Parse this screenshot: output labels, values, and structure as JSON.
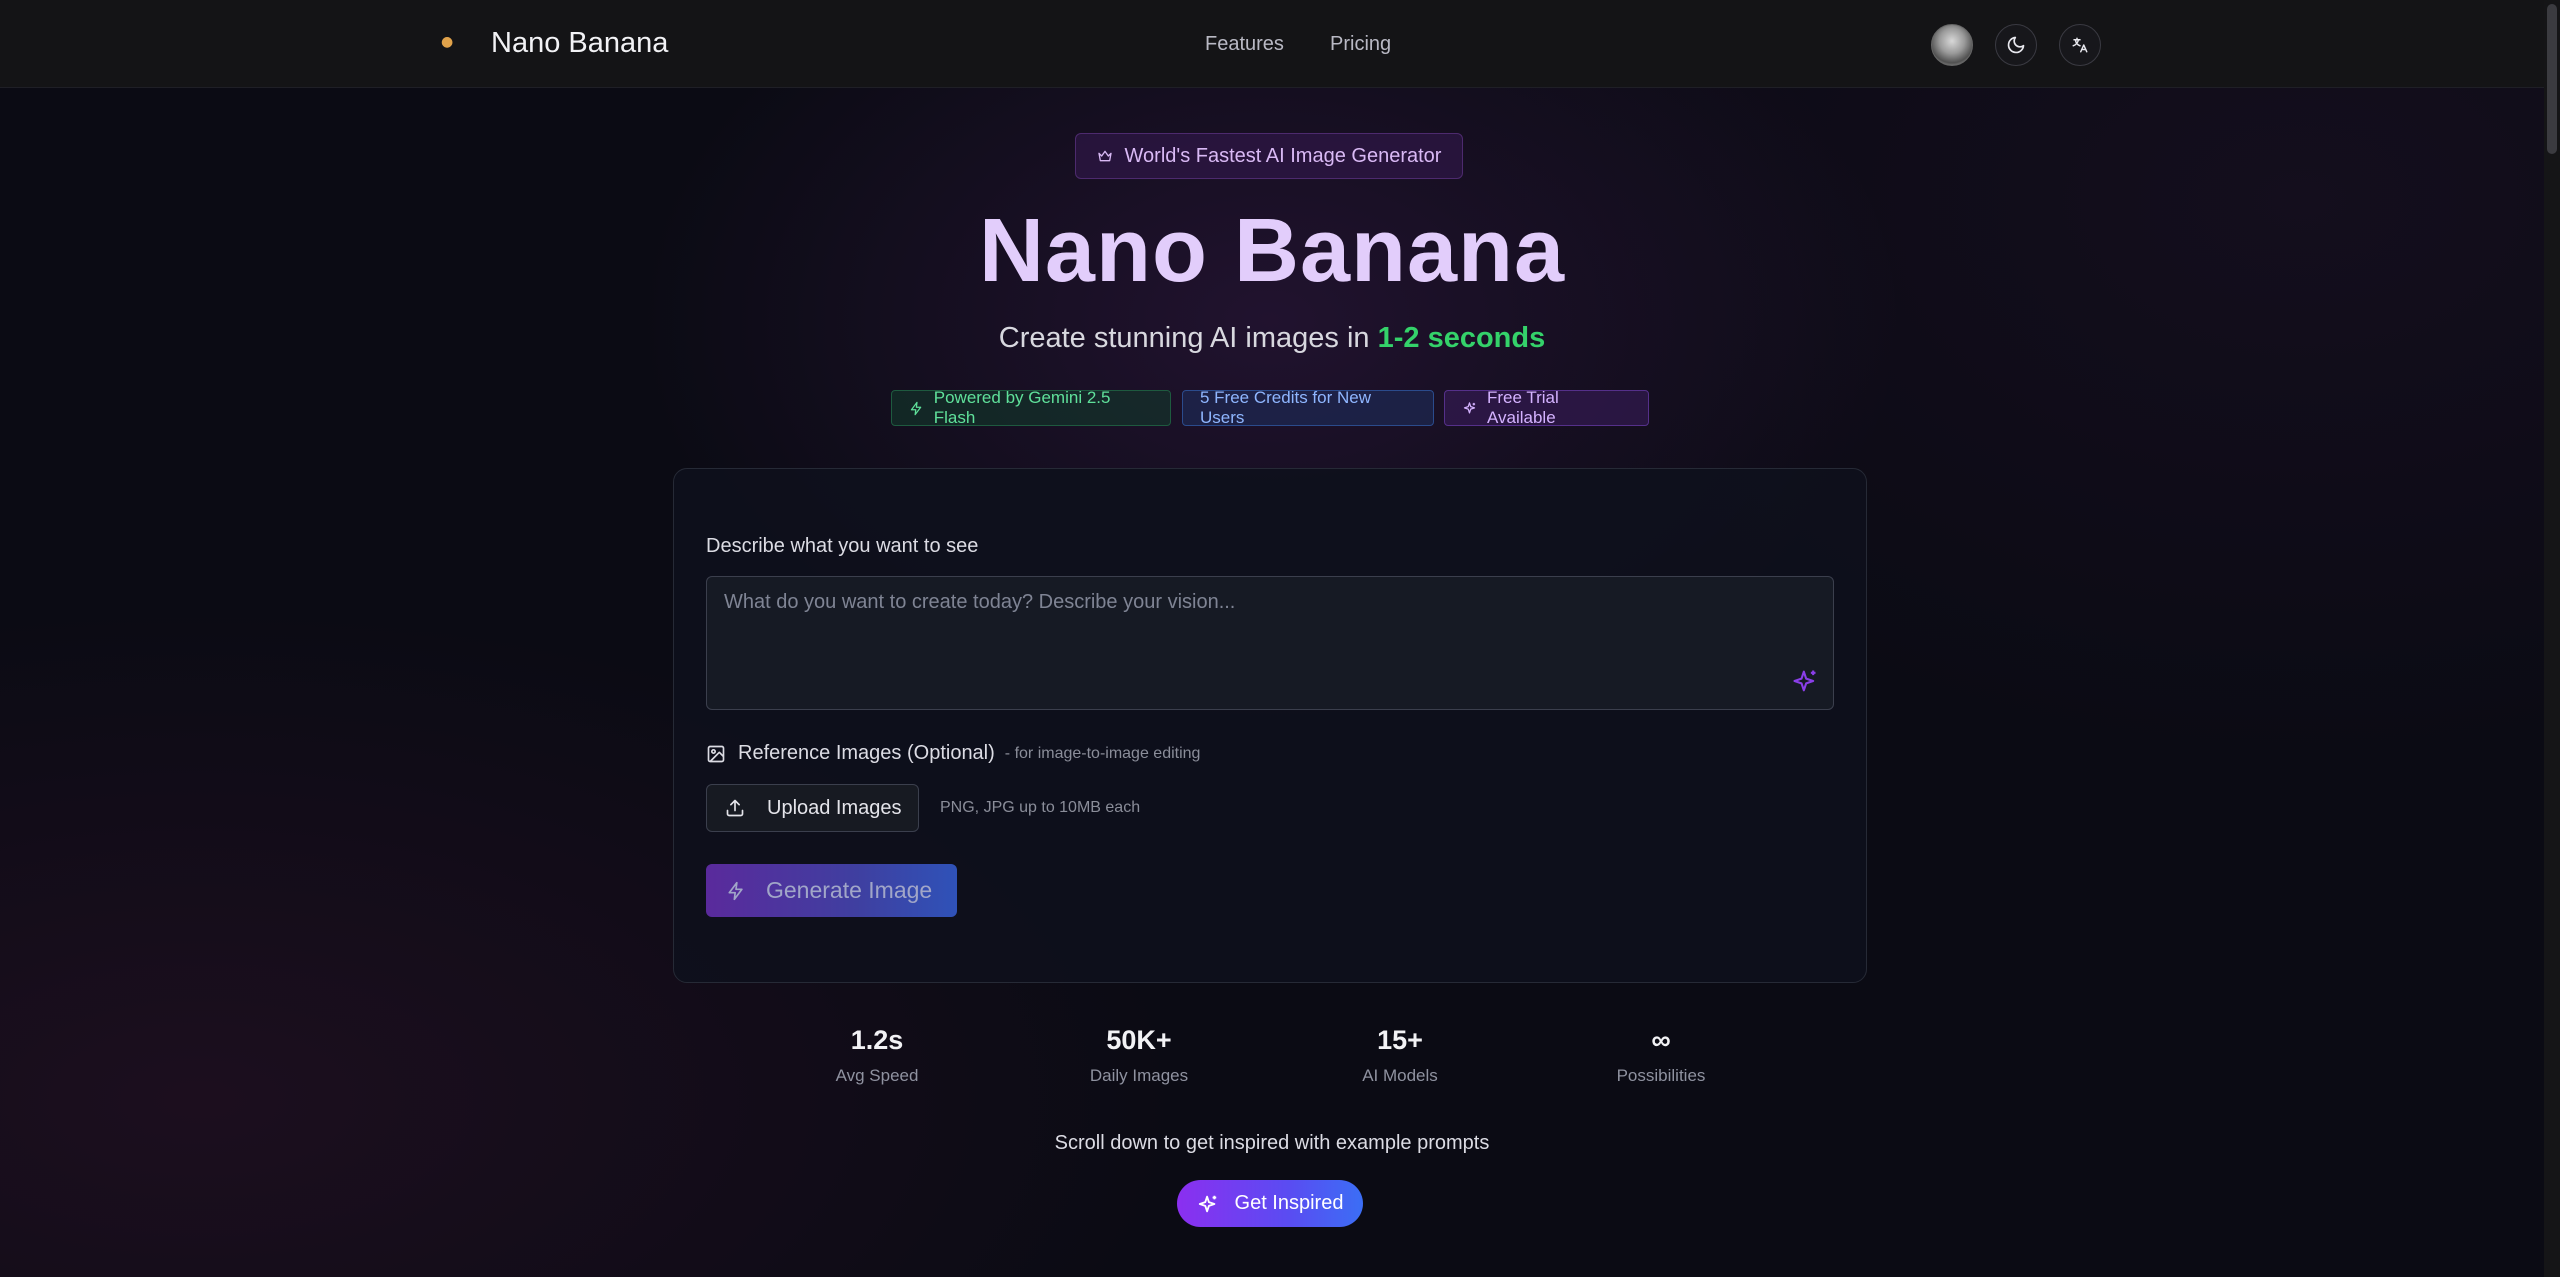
{
  "header": {
    "brand": "Nano Banana",
    "nav": [
      {
        "label": "Features"
      },
      {
        "label": "Pricing"
      }
    ]
  },
  "hero": {
    "pill": "World's Fastest AI Image Generator",
    "title": "Nano Banana",
    "subtitle_prefix": "Create stunning AI images in ",
    "subtitle_highlight": "1-2 seconds",
    "badges": [
      {
        "label": "Powered by Gemini 2.5 Flash"
      },
      {
        "label": "5 Free Credits for New Users"
      },
      {
        "label": "Free Trial Available"
      }
    ]
  },
  "form": {
    "prompt_label": "Describe what you want to see",
    "prompt_placeholder": "What do you want to create today? Describe your vision...",
    "prompt_value": "",
    "reference_label": "Reference Images (Optional)",
    "reference_hint": "- for image-to-image editing",
    "upload_label": "Upload Images",
    "upload_hint": "PNG, JPG up to 10MB each",
    "generate_label": "Generate Image"
  },
  "stats": [
    {
      "value": "1.2s",
      "label": "Avg Speed"
    },
    {
      "value": "50K+",
      "label": "Daily Images"
    },
    {
      "value": "15+",
      "label": "AI Models"
    },
    {
      "value": "∞",
      "label": "Possibilities"
    }
  ],
  "footer": {
    "scroll_text": "Scroll down to get inspired with example prompts",
    "inspire_label": "Get Inspired"
  },
  "colors": {
    "accent_purple": "#8b2ff0",
    "accent_blue": "#3b6ef5",
    "highlight_green": "#34d26a",
    "title": "#e2cdfb"
  }
}
